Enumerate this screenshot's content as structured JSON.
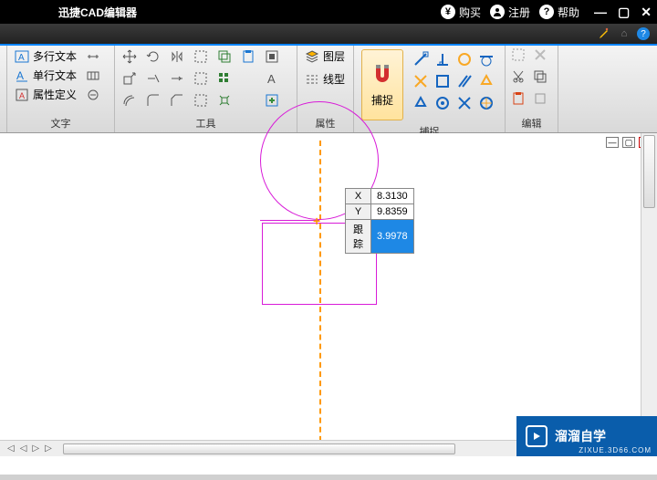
{
  "titlebar": {
    "app_title": "迅捷CAD编辑器",
    "buy": "购买",
    "register": "注册",
    "help": "帮助"
  },
  "ribbon": {
    "text": {
      "label": "文字",
      "mtext": "多行文本",
      "stext": "单行文本",
      "attdef": "属性定义"
    },
    "tools": {
      "label": "工具"
    },
    "props": {
      "label": "属性",
      "layer": "图层",
      "ltype": "线型"
    },
    "snap": {
      "label": "捕捉",
      "big": "捕捉"
    },
    "edit": {
      "label": "编辑"
    }
  },
  "coords": {
    "x_label": "X",
    "x_value": "8.3130",
    "y_label": "Y",
    "y_value": "9.8359",
    "track_label": "跟踪",
    "track_value": "3.9978"
  },
  "scroll_tabs": [
    "◁",
    "◁",
    "▷",
    "▷"
  ],
  "watermark": {
    "brand": "溜溜自学",
    "url": "ZIXUE.3D66.COM"
  }
}
